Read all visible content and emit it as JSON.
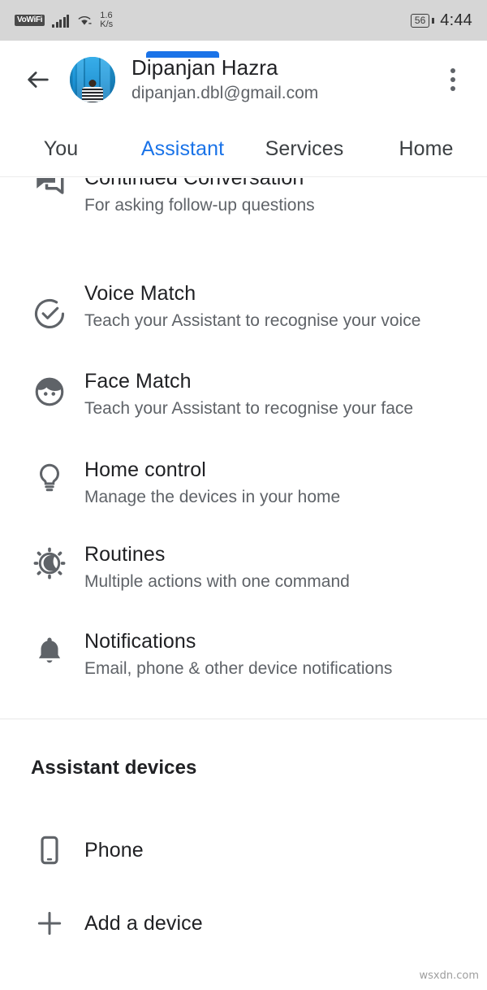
{
  "statusbar": {
    "network_badge": "VoWiFi",
    "signal_icon": "signal-bars-icon",
    "wifi_icon": "wifi-icon",
    "data_rate_value": "1.6",
    "data_rate_unit": "K/s",
    "battery_percent": "56",
    "time": "4:44"
  },
  "header": {
    "back_icon": "back-arrow-icon",
    "avatar_icon": "user-avatar-photo",
    "user_name": "Dipanjan Hazra",
    "user_email": "dipanjan.dbl@gmail.com",
    "overflow_icon": "more-vertical-icon"
  },
  "tabs": {
    "active_index": 1,
    "accent_color": "#1a73e8",
    "items": [
      {
        "label": "You"
      },
      {
        "label": "Assistant"
      },
      {
        "label": "Services"
      },
      {
        "label": "Home"
      }
    ]
  },
  "settings": {
    "items": [
      {
        "icon": "forum-icon",
        "title": "Continued Conversation",
        "subtitle": "For asking follow-up questions"
      },
      {
        "icon": "check-circle-icon",
        "title": "Voice Match",
        "subtitle": "Teach your Assistant to recognise your voice"
      },
      {
        "icon": "face-icon",
        "title": "Face Match",
        "subtitle": "Teach your Assistant to recognise your face"
      },
      {
        "icon": "lightbulb-icon",
        "title": "Home control",
        "subtitle": "Manage the devices in your home"
      },
      {
        "icon": "routines-sun-moon-icon",
        "title": "Routines",
        "subtitle": "Multiple actions with one command"
      },
      {
        "icon": "bell-icon",
        "title": "Notifications",
        "subtitle": "Email, phone & other device notifications"
      }
    ]
  },
  "devices": {
    "section_title": "Assistant devices",
    "items": [
      {
        "icon": "smartphone-icon",
        "label": "Phone"
      },
      {
        "icon": "plus-icon",
        "label": "Add a device"
      }
    ]
  },
  "watermark": {
    "text": "wsxdn.com"
  }
}
